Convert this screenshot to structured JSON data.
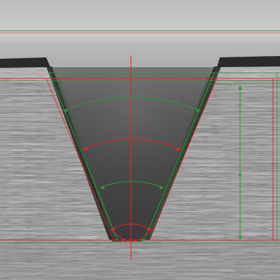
{
  "image": {
    "description": "",
    "colors": {
      "background_top": "#c9c9c9",
      "background_mid": "#9a9a9a",
      "groove_dark": "#3f3f3f",
      "groove_light": "#6a6a6a",
      "metal_base": "#8e8e8e",
      "metal_light": "#cfcfcf",
      "metal_dark": "#4a4a4a",
      "overlay_red": "#e0262a",
      "overlay_green": "#2e9a3a",
      "surface_edge": "#222222"
    }
  }
}
